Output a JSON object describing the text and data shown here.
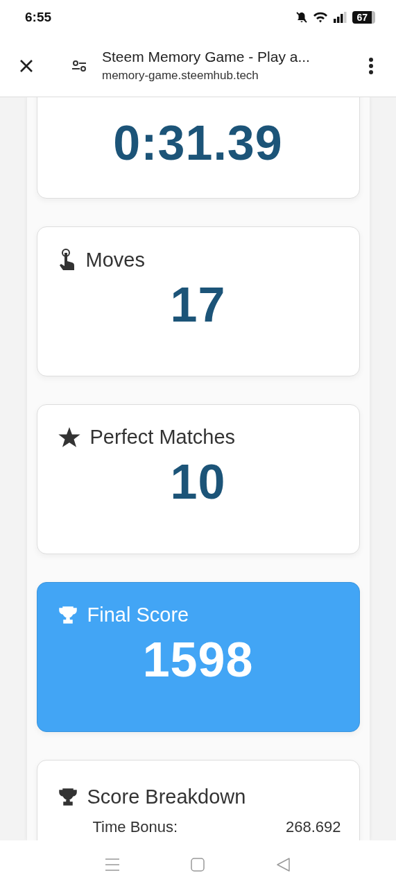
{
  "status_bar": {
    "time": "6:55",
    "battery": "67"
  },
  "browser_bar": {
    "title": "Steem Memory Game - Play a...",
    "url": "memory-game.steemhub.tech"
  },
  "cards": [
    {
      "kind": "time",
      "value": "0:31.39"
    },
    {
      "kind": "moves",
      "label": "Moves",
      "value": "17"
    },
    {
      "kind": "matches",
      "label": "Perfect Matches",
      "value": "10"
    },
    {
      "kind": "score",
      "label": "Final Score",
      "value": "1598"
    }
  ],
  "breakdown": {
    "title": "Score Breakdown",
    "rows": [
      {
        "label": "Time Bonus:",
        "value": "268.692"
      }
    ]
  }
}
